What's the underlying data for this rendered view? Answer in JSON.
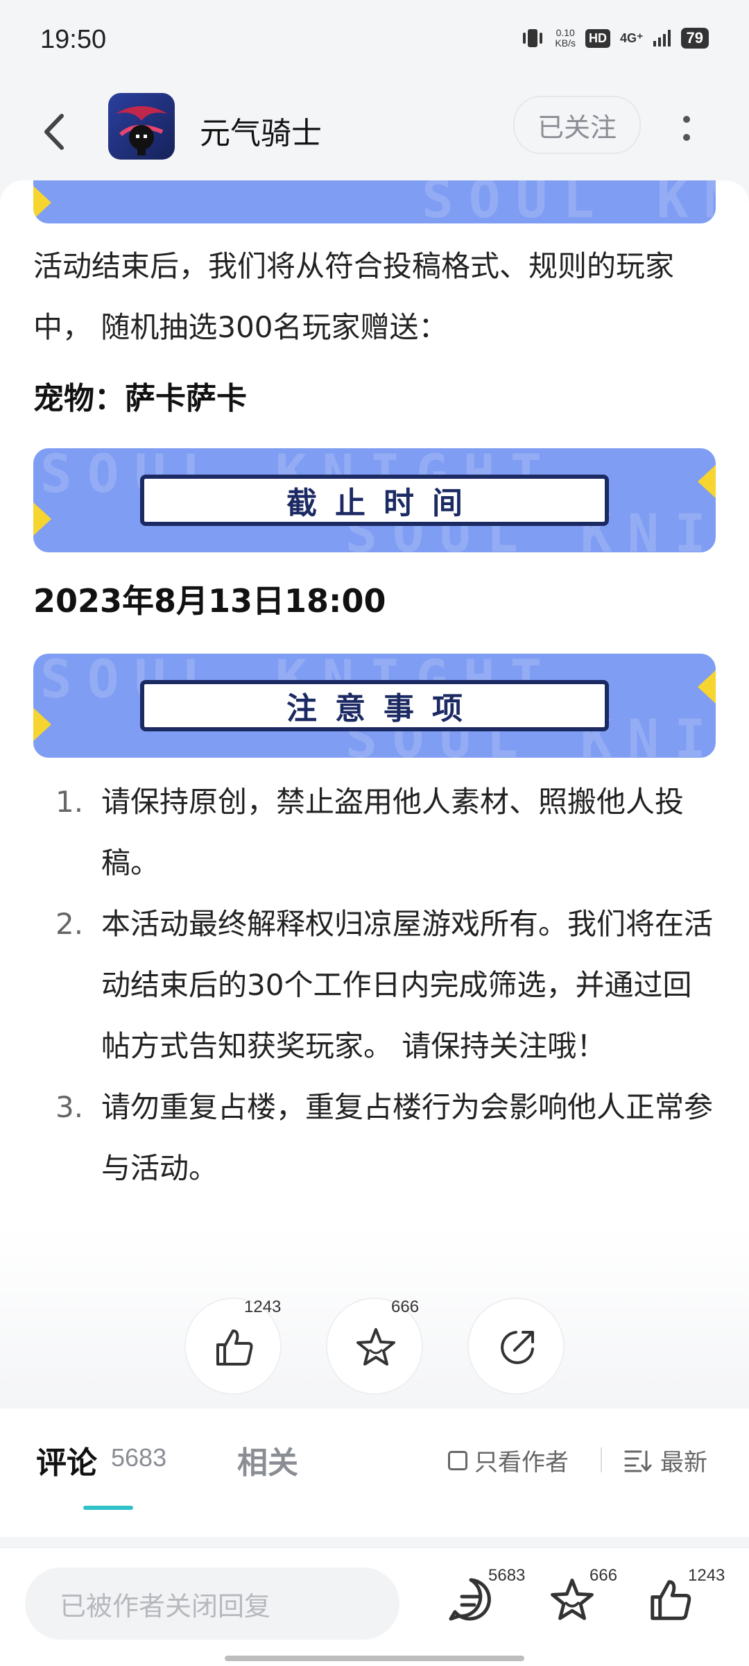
{
  "status": {
    "time": "19:50",
    "net_speed_value": "0.10",
    "net_speed_unit": "KB/s",
    "hd": "HD",
    "network": "4G⁺",
    "battery": "79"
  },
  "header": {
    "app_name": "元气骑士",
    "follow_label": "已关注"
  },
  "post": {
    "para_prefix": "活动结束后，我们将从符合投稿格式、规则的玩家中，  随机抽选300名玩家赠送：",
    "prize": "宠物：萨卡萨卡",
    "deadline_banner": "截止时间",
    "deadline": "2023年8月13日18:00",
    "notes_banner": "注意事项",
    "notes": [
      {
        "num": "1.",
        "text": "请保持原创，禁止盗用他人素材、照搬他人投稿。"
      },
      {
        "num": "2.",
        "text": "本活动最终解释权归凉屋游戏所有。我们将在活动结束后的30个工作日内完成筛选，并通过回帖方式告知获奖玩家。  请保持关注哦！"
      },
      {
        "num": "3.",
        "text": "请勿重复占楼，重复占楼行为会影响他人正常参与活动。"
      }
    ],
    "watermark": "SOUL KNIGHT"
  },
  "actions": {
    "likes": "1243",
    "favorites": "666"
  },
  "tabs": {
    "comments_label": "评论",
    "comments_count": "5683",
    "related_label": "相关",
    "only_author_label": "只看作者",
    "sort_label": "最新"
  },
  "bottom": {
    "reply_placeholder": "已被作者关闭回复",
    "comment_count": "5683",
    "favorite_count": "666",
    "like_count": "1243"
  },
  "colors": {
    "banner_blue": "#7f9df2",
    "banner_navy": "#1c2a63",
    "accent_yellow": "#f7d531",
    "tab_accent": "#2fc3c9"
  }
}
